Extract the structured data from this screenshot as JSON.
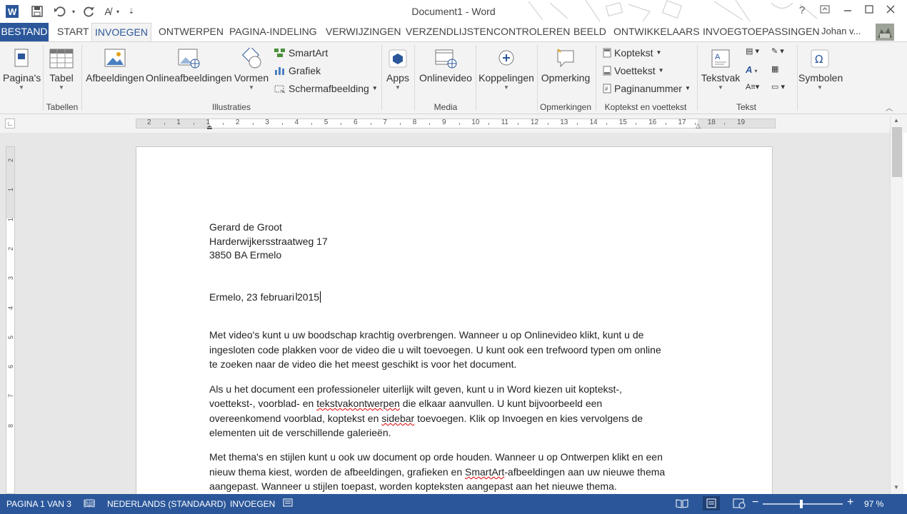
{
  "window": {
    "title": "Document1 - Word",
    "help": "?",
    "controls": [
      "restore-ribbon",
      "minimize",
      "maximize",
      "close"
    ]
  },
  "qat": {
    "icons": [
      "word-logo-icon",
      "save-icon",
      "undo-icon",
      "redo-icon",
      "spelling-icon",
      "customize-qat-icon"
    ]
  },
  "tabs": {
    "file": "BESTAND",
    "items": [
      "START",
      "INVOEGEN",
      "ONTWERPEN",
      "PAGINA-INDELING",
      "VERWIJZINGEN",
      "VERZENDLIJSTEN",
      "CONTROLEREN",
      "BEELD",
      "ONTWIKKELAARS",
      "INVOEGTOEPASSINGEN"
    ],
    "active": "INVOEGEN",
    "user": "Johan v..."
  },
  "ribbon": {
    "pages": "Pagina's",
    "table": "Tabel",
    "group_tables": "Tabellen",
    "pictures": "Afbeeldingen",
    "online_pictures": "Onlineafbeeldingen",
    "shapes": "Vormen",
    "smartart": "SmartArt",
    "chart": "Grafiek",
    "screenshot": "Schermafbeelding",
    "group_illustrations": "Illustraties",
    "apps": "Apps",
    "online_video": "Onlinevideo",
    "group_media": "Media",
    "links": "Koppelingen",
    "comment": "Opmerking",
    "group_comments": "Opmerkingen",
    "header": "Koptekst",
    "footer": "Voettekst",
    "page_number": "Paginanummer",
    "group_header_footer": "Koptekst en voettekst",
    "textbox": "Tekstvak",
    "group_text": "Tekst",
    "symbols": "Symbolen"
  },
  "ruler": {
    "labels": [
      "2",
      "1",
      "1",
      "2",
      "3",
      "4",
      "5",
      "6",
      "7",
      "8",
      "9",
      "10",
      "11",
      "12",
      "13",
      "14",
      "15",
      "16",
      "17",
      "18",
      "19"
    ],
    "vlabels": [
      "2",
      "1",
      "1",
      "2",
      "3",
      "4",
      "5",
      "6",
      "7",
      "8"
    ]
  },
  "document": {
    "address": [
      "Gerard de Groot",
      "Harderwijkersstraatweg 17",
      "3850 BA Ermelo"
    ],
    "date": "Ermelo, 23 februari 2015",
    "p1": [
      "Met video's kunt u uw boodschap krachtig overbrengen. Wanneer u op Onlinevideo klikt, kunt u de",
      "ingesloten code plakken voor de video die u wilt toevoegen. U kunt ook een trefwoord typen om online",
      "te zoeken naar de video die het meest geschikt is voor het document."
    ],
    "p2_l1": "Als u het document een professioneler uiterlijk wilt geven, kunt u in Word kiezen uit koptekst-,",
    "p2_l2a": "voettekst-, voorblad- en ",
    "p2_l2b": "tekstvakontwerpen",
    "p2_l2c": " die elkaar aanvullen. U kunt bijvoorbeeld een",
    "p2_l3a": "overeenkomend voorblad, koptekst en ",
    "p2_l3b": "sidebar",
    "p2_l3c": " toevoegen. Klik op Invoegen en kies vervolgens de",
    "p2_l4": "elementen uit de verschillende galerieën.",
    "p3_l1": "Met thema's en stijlen kunt u ook uw document op orde houden. Wanneer u op Ontwerpen klikt en een",
    "p3_l2a": "nieuw thema kiest, worden de afbeeldingen, grafieken en ",
    "p3_l2b": "SmartArt",
    "p3_l2c": "-afbeeldingen aan uw nieuwe thema",
    "p3_l3": "aangepast. Wanneer u stijlen toepast, worden kopteksten aangepast aan het nieuwe thema."
  },
  "status": {
    "page": "PAGINA 1 VAN 3",
    "language": "NEDERLANDS (STANDAARD)",
    "mode": "INVOEGEN",
    "zoom": "97 %",
    "zoom_level": 0.97
  },
  "colors": {
    "accent": "#2b579a",
    "ribbon_bg": "#f3f3f3",
    "doc_bg": "#e7e7e7"
  }
}
